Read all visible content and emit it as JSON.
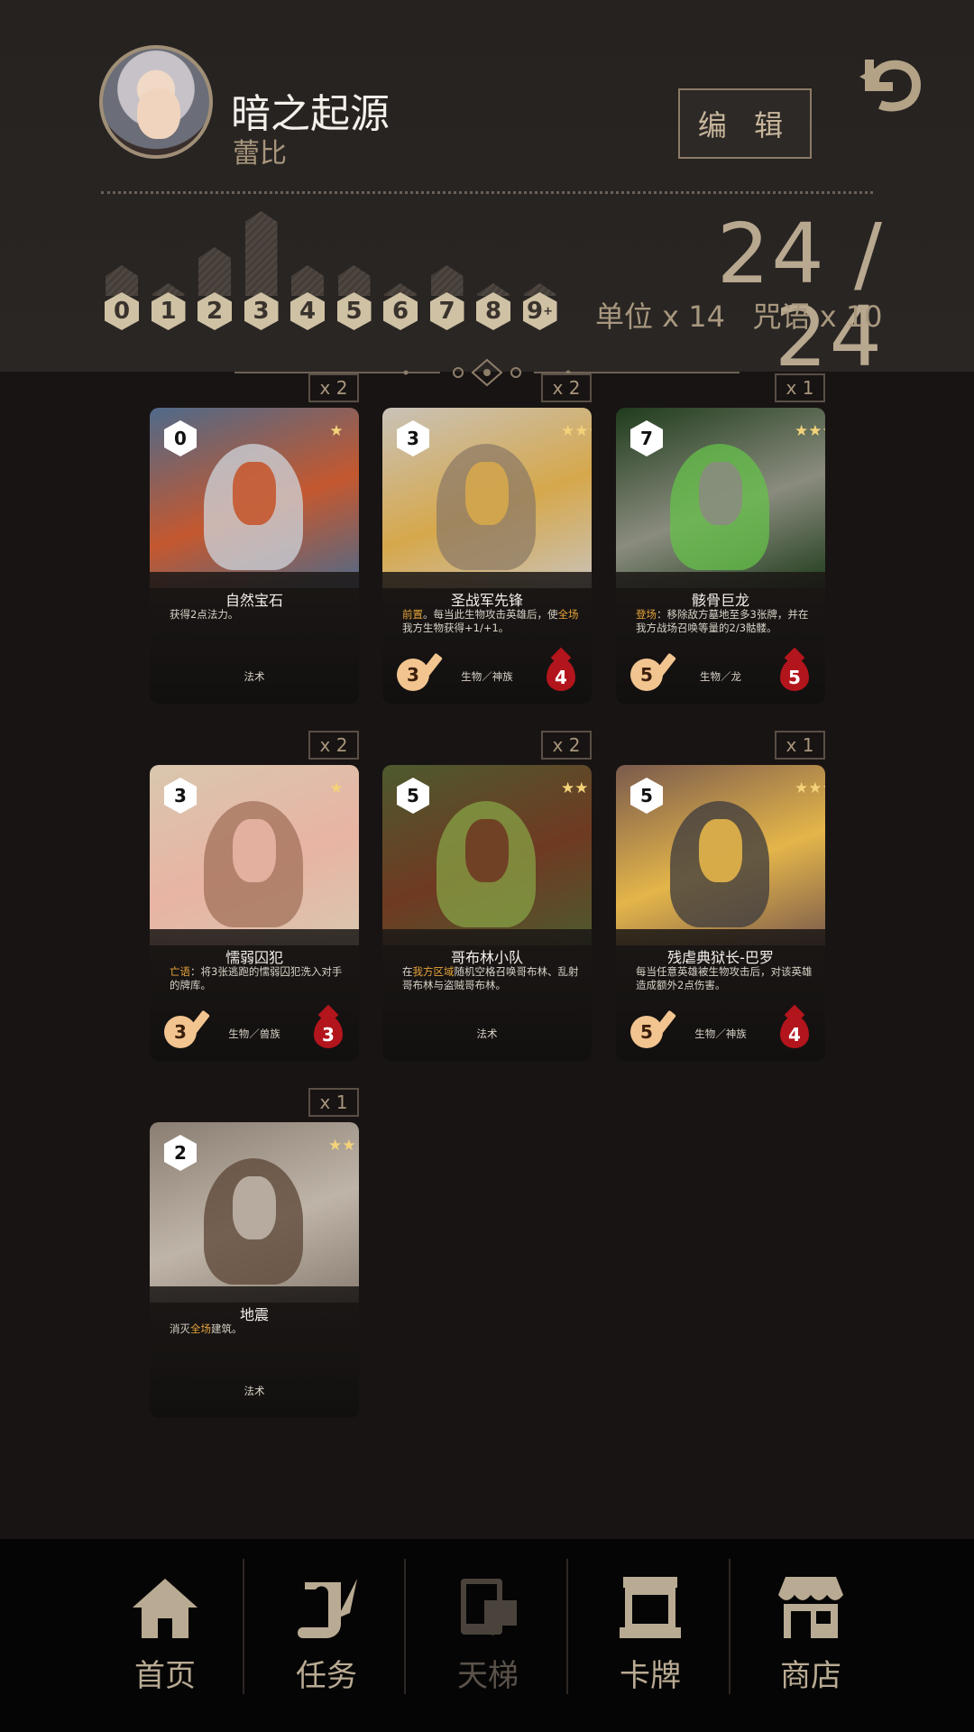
{
  "header": {
    "deck_name": "暗之起源",
    "hero_name": "蕾比",
    "edit_label": "编 辑",
    "count": "24 / 24",
    "units_label": "单位 x 14",
    "spells_label": "咒语 x 10"
  },
  "cost_curve": [
    {
      "label": "0",
      "count": 1
    },
    {
      "label": "1",
      "count": 0
    },
    {
      "label": "2",
      "count": 2
    },
    {
      "label": "3",
      "count": 4
    },
    {
      "label": "4",
      "count": 1
    },
    {
      "label": "5",
      "count": 1
    },
    {
      "label": "6",
      "count": 0
    },
    {
      "label": "7",
      "count": 1
    },
    {
      "label": "8",
      "count": 0
    },
    {
      "label": "9",
      "sup": "+",
      "count": 0
    }
  ],
  "cards": [
    {
      "copies": "x 2",
      "cost": "0",
      "stars": "★",
      "name": "自然宝石",
      "desc_parts": [
        {
          "t": "获得2点法力。"
        }
      ],
      "type": "法术",
      "atk": "",
      "hp": "",
      "art": [
        "#4e6a8a",
        "#cfd6dc",
        "#c4582f"
      ]
    },
    {
      "copies": "x 2",
      "cost": "3",
      "stars": "★★★★",
      "name": "圣战军先锋",
      "desc_parts": [
        {
          "t": "前置",
          "kw": true
        },
        {
          "t": "。每当此生物攻击英雄后，使"
        },
        {
          "t": "全场",
          "kw": true
        },
        {
          "t": "我方生物获得+1/+1。"
        }
      ],
      "type": "生物／神族",
      "atk": "3",
      "hp": "4",
      "art": [
        "#c9c2b8",
        "#8d7b66",
        "#d6a84c"
      ]
    },
    {
      "copies": "x 1",
      "cost": "7",
      "stars": "★★★",
      "name": "骸骨巨龙",
      "desc_parts": [
        {
          "t": "登场",
          "kw": true
        },
        {
          "t": "：移除敌方墓地至多3张牌，并在我方战场召唤等量的2/3骷髅。"
        }
      ],
      "type": "生物／龙",
      "atk": "5",
      "hp": "5",
      "art": [
        "#1f3b1c",
        "#66c24a",
        "#8a8c7e"
      ]
    },
    {
      "copies": "x 2",
      "cost": "3",
      "stars": "★",
      "name": "懦弱囚犯",
      "desc_parts": [
        {
          "t": "亡语",
          "kw": true
        },
        {
          "t": "：将3张逃跑的懦弱囚犯洗入对手的牌库。"
        }
      ],
      "type": "生物／兽族",
      "atk": "3",
      "hp": "3",
      "art": [
        "#d9c7ae",
        "#a1705a",
        "#e8b4a4"
      ]
    },
    {
      "copies": "x 2",
      "cost": "5",
      "stars": "★★",
      "name": "哥布林小队",
      "desc_parts": [
        {
          "t": "在"
        },
        {
          "t": "我方区域",
          "kw": true
        },
        {
          "t": "随机空格召唤哥布林、乱射哥布林与盗贼哥布林。"
        }
      ],
      "type": "法术",
      "atk": "",
      "hp": "",
      "art": [
        "#4d5a2e",
        "#87a145",
        "#6f3a22"
      ]
    },
    {
      "copies": "x 1",
      "cost": "5",
      "stars": "★★★★★",
      "name": "残虐典狱长-巴罗",
      "desc_parts": [
        {
          "t": "每当任意英雄被生物攻击后，对该英雄造成额外2点伤害。"
        }
      ],
      "type": "生物／神族",
      "atk": "5",
      "hp": "4",
      "art": [
        "#7a5a4c",
        "#3b3a3e",
        "#e4b54a"
      ]
    },
    {
      "copies": "x 1",
      "cost": "2",
      "stars": "★★",
      "name": "地震",
      "desc_parts": [
        {
          "t": "消灭"
        },
        {
          "t": "全场",
          "kw": true
        },
        {
          "t": "建筑。"
        }
      ],
      "type": "法术",
      "atk": "",
      "hp": "",
      "art": [
        "#8a7e72",
        "#5b4434",
        "#bfb4a8"
      ]
    }
  ],
  "nav": [
    {
      "label": "首页",
      "icon": "home-icon",
      "enabled": true
    },
    {
      "label": "任务",
      "icon": "quest-scroll-icon",
      "enabled": true
    },
    {
      "label": "天梯",
      "icon": "ladder-icon",
      "enabled": false
    },
    {
      "label": "卡牌",
      "icon": "cards-icon",
      "enabled": true
    },
    {
      "label": "商店",
      "icon": "shop-icon",
      "enabled": true
    }
  ],
  "colors": {
    "accent": "#b8a88f",
    "keyword": "#e7a43b",
    "hp": "#b3151c",
    "atk": "#f2c48f"
  }
}
